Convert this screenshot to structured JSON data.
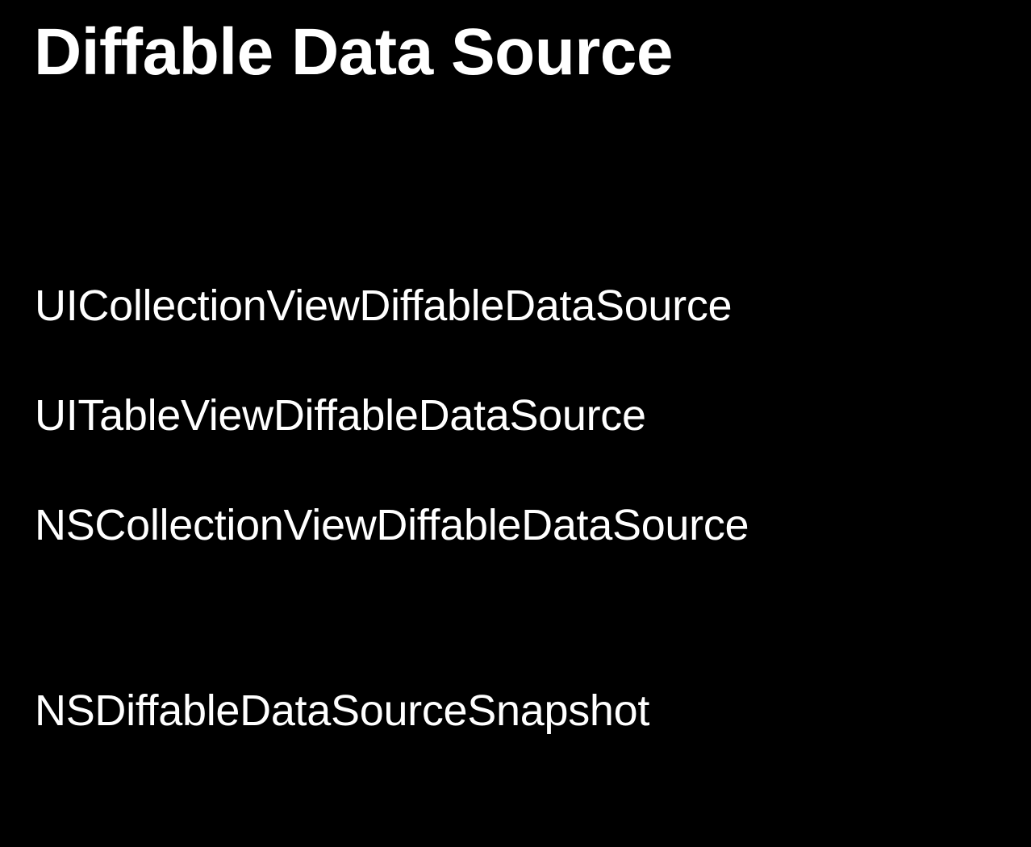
{
  "slide": {
    "title": "Diffable Data Source",
    "items": [
      "UICollectionViewDiffableDataSource",
      "UITableViewDiffableDataSource",
      "NSCollectionViewDiffableDataSource"
    ],
    "secondary_item": "NSDiffableDataSourceSnapshot"
  }
}
